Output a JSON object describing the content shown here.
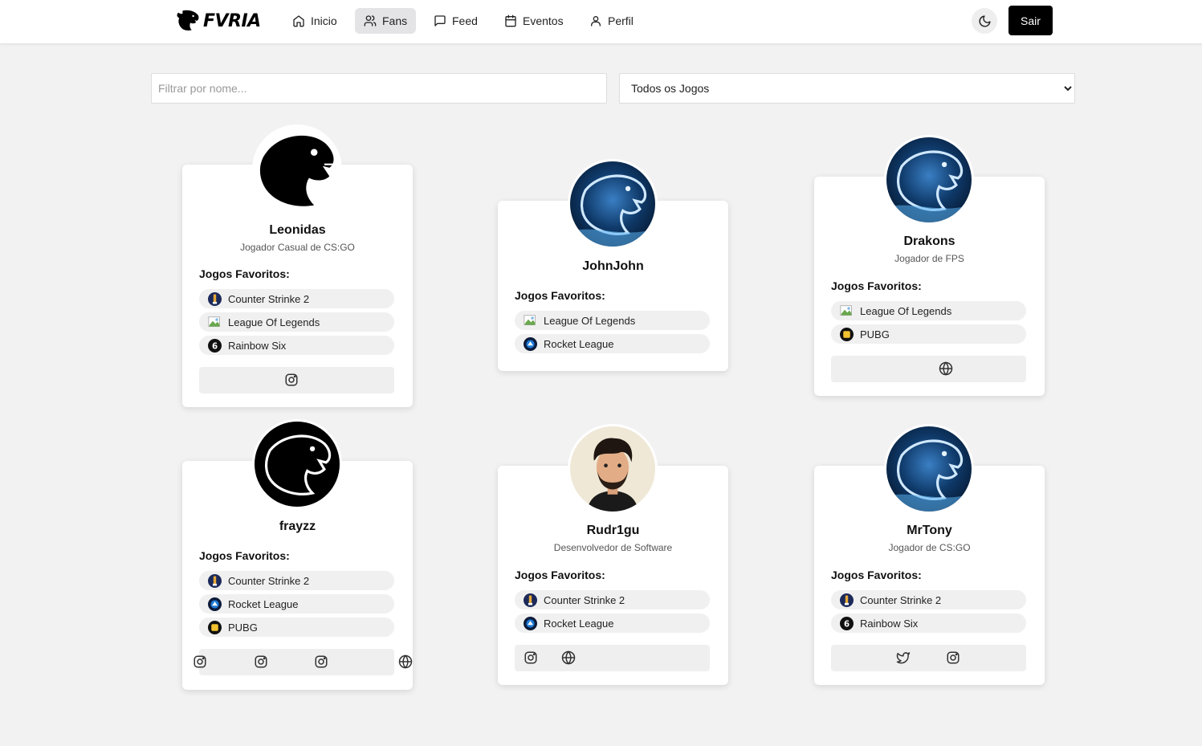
{
  "brand": {
    "name": "FVRIA"
  },
  "nav": {
    "items": [
      {
        "label": "Inicio",
        "icon": "home-icon"
      },
      {
        "label": "Fans",
        "icon": "users-icon",
        "active": true
      },
      {
        "label": "Feed",
        "icon": "message-square-icon"
      },
      {
        "label": "Eventos",
        "icon": "calendar-icon"
      },
      {
        "label": "Perfil",
        "icon": "user-icon"
      }
    ],
    "theme_icon": "moon-icon",
    "logout_label": "Sair"
  },
  "filters": {
    "name_placeholder": "Filtrar por nome...",
    "game_selected": "Todos os Jogos"
  },
  "fav_label": "Jogos Favoritos:",
  "fans": [
    {
      "name": "Leonidas",
      "subtitle": "Jogador Casual de CS:GO",
      "avatar": "panther-black-icon",
      "games": [
        "Counter Strinke 2",
        "League Of Legends",
        "Rainbow Six"
      ],
      "socials": [
        "instagram-icon"
      ]
    },
    {
      "name": "JohnJohn",
      "subtitle": "",
      "avatar": "panther-blue-icon",
      "games": [
        "League Of Legends",
        "Rocket League"
      ],
      "socials": []
    },
    {
      "name": "Drakons",
      "subtitle": "Jogador de FPS",
      "avatar": "panther-blue-icon",
      "games": [
        "League Of Legends",
        "PUBG"
      ],
      "socials": [
        "globe-icon"
      ]
    },
    {
      "name": "frayzz",
      "subtitle": "",
      "avatar": "panther-white-icon",
      "games": [
        "Counter Strinke 2",
        "Rocket League",
        "PUBG"
      ],
      "socials": [
        "instagram-icon",
        "instagram-icon",
        "instagram-icon",
        "globe-icon"
      ]
    },
    {
      "name": "Rudr1gu",
      "subtitle": "Desenvolvedor de Software",
      "avatar": "cartoon-man-icon",
      "games": [
        "Counter Strinke 2",
        "Rocket League"
      ],
      "socials": [
        "instagram-icon",
        "globe-icon"
      ]
    },
    {
      "name": "MrTony",
      "subtitle": "Jogador de CS:GO",
      "avatar": "panther-blue-icon",
      "games": [
        "Counter Strinke 2",
        "Rainbow Six"
      ],
      "socials": [
        "twitter-icon",
        "instagram-icon"
      ]
    }
  ]
}
